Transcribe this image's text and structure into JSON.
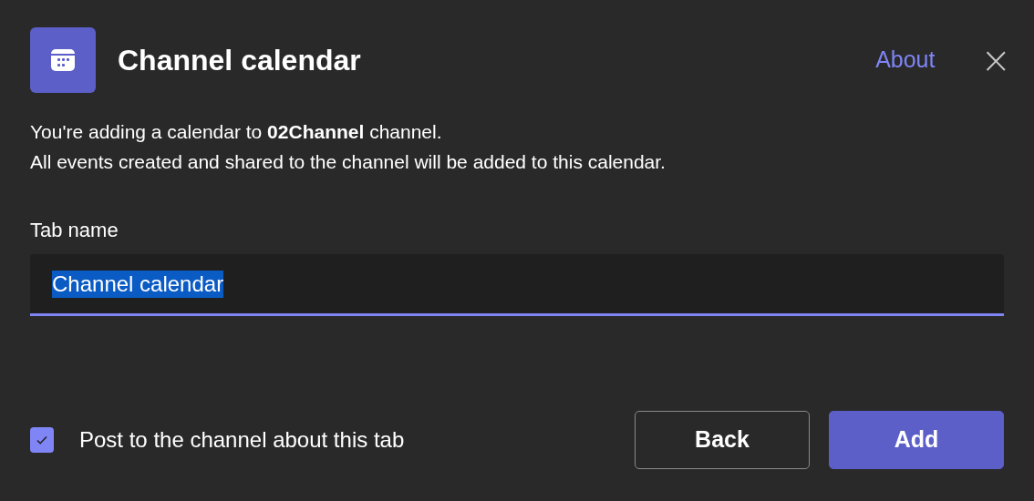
{
  "dialog": {
    "title": "Channel calendar",
    "about_link": "About",
    "close": "×"
  },
  "description": [
    "You're adding a calendar to **02Channel** channel.",
    "All events created and shared to the channel will be added to this calendar."
  ],
  "tab_name": {
    "label": "Tab name",
    "value": "Channel calendar",
    "value_selected": true
  },
  "post_option": {
    "label": "Post to the channel about this tab",
    "checked": true
  },
  "buttons": [
    {
      "label": "Back",
      "kind": "secondary"
    },
    {
      "label": "Add",
      "kind": "primary"
    }
  ]
}
